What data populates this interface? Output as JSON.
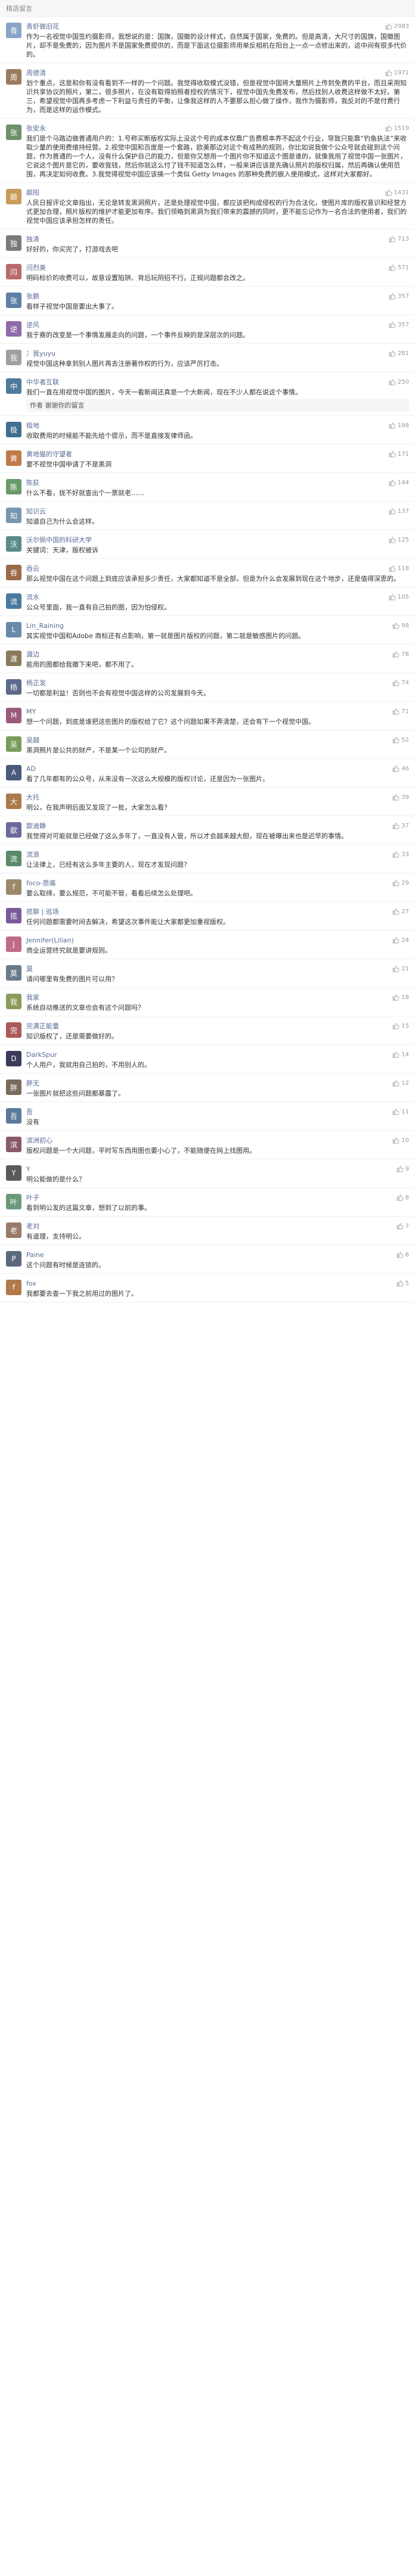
{
  "section_title": "精选留言",
  "comments": [
    {
      "name": "青虾做旧花",
      "likes": "2983",
      "avatar_color": "#8aa4c8",
      "avatar_char": "青",
      "text": "作为一名视觉中国签约摄影师，我想说的是：国旗，国徽的设计样式，自然属于国家，免费的。但是高清，大尺寸的国旗，国徽图片，却不是免费的，因为图片不是国家免费提供的，而是下面这位摄影师用单反相机在阳台上一点一点修出来的，这中间有很多代价的。"
    },
    {
      "name": "周德清",
      "likes": "1971",
      "avatar_color": "#9a7b5e",
      "avatar_char": "周",
      "text": "划个重点，这是和你有没有看到不一样的一个问题。我觉得收取模式没错，但是视觉中国将大量照片上传到免费的平台，而且采用知识共享协议的照片，第二，很多照片，在没有取得拍照者授权的情况下，视觉中国先免费发布，然后找别人收费这样做不太好。第三，希望视觉中国再多考虑一下利益与责任的平衡，让像我这样的人不要那么担心做了操作，我作为摄影师，我反对的不是付费行为，而是这样的运作模式。"
    },
    {
      "name": "张安永",
      "likes": "1519",
      "avatar_color": "#6f8f6a",
      "avatar_char": "张",
      "text": "我们是个马路边做普通用户的：1.号称买断版权实际上没这个号的成本仅靠广告费根本养不起这个行业，导致只能靠“钓鱼执法”来收取少量的使用费维持经营。2.视觉中国和百度是一个套路，欧美那边对这个有成熟的规则，你比如说我做个公众号就会碰到这个问题，作为普通的一个人，没有什么保护自己的能力，但是你又想用一个图片你不知道这个图是谁的，就像我用了视觉中国一张图片，它说这个图片是它的，要收我钱，然后你就这么付了钱不知道怎么样，一般来讲应该是先确认照片的版权归属，然后再确认使用范围，再决定如何收费。3.我觉得视觉中国应该搞一个类似 Getty Images 的那种免费的嵌入使用模式，这样对大家都好。"
    },
    {
      "name": "颠阳",
      "likes": "1431",
      "avatar_color": "#c89b5a",
      "avatar_char": "颠",
      "text": "人民日报评论文章指出，无论是转发黑洞照片，还是处理视觉中国，都应该把构成侵权的行为合法化，使图片库的版权意识和经营方式更加合理，照片版权的维护才能更加有序。我们领略到黑洞为我们带来的震撼的同时，更不能忘记作为一名合法的使用者，我们的视觉中国应该承担怎样的责任。"
    },
    {
      "name": "独清",
      "likes": "713",
      "avatar_color": "#7a7a7a",
      "avatar_char": "独",
      "text": "好好的，你买完了，打游戏去吧"
    },
    {
      "name": "闫烈美",
      "likes": "571",
      "avatar_color": "#b86b6b",
      "avatar_char": "闫",
      "text": "明码标价的收费可以，故意设置陷阱、背后玩阴招不行。正规问题都会改之。"
    },
    {
      "name": "张鹏",
      "likes": "357",
      "avatar_color": "#5d7fa3",
      "avatar_char": "张",
      "text": "看样子视觉中国是要出大事了。"
    },
    {
      "name": "逆风",
      "likes": "357",
      "avatar_color": "#8c6ba8",
      "avatar_char": "逆",
      "text": "我于赛的改变是一个事情发展走向的问题，一个事件反映的是深层次的问题。"
    },
    {
      "name": "冫我yuyu",
      "likes": "281",
      "avatar_color": "#a0a0a0",
      "avatar_char": "我",
      "text": "视觉中国这种拿到别人图片再去注册著作权的行为，应该严厉打击。"
    },
    {
      "name": "中华者互联",
      "likes": "250",
      "avatar_color": "#4f7a9a",
      "avatar_char": "中",
      "text": "我们一直在用视觉中国的图片，今天一看新闻还真是一个大新闻，现在不少人都在说这个事情。",
      "reply": "作者 谢谢你的留言"
    },
    {
      "name": "极地",
      "likes": "198",
      "avatar_color": "#3f6e8f",
      "avatar_char": "极",
      "text": "收取费用的时候能不能先给个提示，而不是直接发律师函。"
    },
    {
      "name": "黄地猫的守望者",
      "likes": "171",
      "avatar_color": "#c07a48",
      "avatar_char": "黄",
      "text": "要不视觉中国申请了不是黑洞"
    },
    {
      "name": "陈荻",
      "likes": "144",
      "avatar_color": "#6a9a6a",
      "avatar_char": "陈",
      "text": "什么不看，拢不好就查出个一票就老……"
    },
    {
      "name": "知识云",
      "likes": "137",
      "avatar_color": "#7896b0",
      "avatar_char": "知",
      "text": "知道自己为什么会这样。"
    },
    {
      "name": "沃尔佩中国的科研大学",
      "likes": "125",
      "avatar_color": "#5a8a8a",
      "avatar_char": "沃",
      "text": "关键词：天津，版权被诉"
    },
    {
      "name": "吞云",
      "likes": "118",
      "avatar_color": "#9a6a4a",
      "avatar_char": "吞",
      "text": "那么视觉中国在这个问题上到底应该承担多少责任，大家都知道不是全部，但是为什么会发展到现在这个地步，还是值得深思的。"
    },
    {
      "name": "流水",
      "likes": "105",
      "avatar_color": "#4a7aa0",
      "avatar_char": "流",
      "text": "公众号里面，我一直有自己拍的图，因为怕侵权。"
    },
    {
      "name": "Lin_Raining",
      "likes": "98",
      "avatar_color": "#6a8aaa",
      "avatar_char": "L",
      "text": "其实视觉中国和Adobe 商标还有点影响，第一就是图片版权的问题，第二就是敏感图片的问题。"
    },
    {
      "name": "渡边",
      "likes": "76",
      "avatar_color": "#8a7a5a",
      "avatar_char": "渡",
      "text": "能用的图都给我撤下来吧，都不用了。"
    },
    {
      "name": "杨正发",
      "likes": "74",
      "avatar_color": "#5a6a8a",
      "avatar_char": "杨",
      "text": "一切都是利益！否则也不会有视觉中国这样的公司发展到今天。"
    },
    {
      "name": "MY",
      "likes": "71",
      "avatar_color": "#9a5a7a",
      "avatar_char": "M",
      "text": "想一个问题，到底是谁把这些图片的版权给了它？这个问题如果不弄清楚，还会有下一个视觉中国。"
    },
    {
      "name": "吴越",
      "likes": "52",
      "avatar_color": "#7a9a5a",
      "avatar_char": "吴",
      "text": "黑洞照片是公共的财产，不是某一个公司的财产。"
    },
    {
      "name": "AD",
      "likes": "46",
      "avatar_color": "#4a5a7a",
      "avatar_char": "A",
      "text": "看了几年都有的公众号，从来没有一次这么大规模的版权讨论，还是因为一张图片。"
    },
    {
      "name": "大托",
      "likes": "39",
      "avatar_color": "#aa7a4a",
      "avatar_char": "大",
      "text": "明公，在我声明后面又发现了一批，大家怎么看？"
    },
    {
      "name": "歆迪静",
      "likes": "37",
      "avatar_color": "#6a6a9a",
      "avatar_char": "歆",
      "text": "我觉得对可能就是已经做了这么多年了，一直没有人管，所以才会越来越大胆，现在被曝出来也是迟早的事情。"
    },
    {
      "name": "流浪",
      "likes": "33",
      "avatar_color": "#5a8a6a",
      "avatar_char": "流",
      "text": "让法律上，已经有这么多年主要的人，现在才发现问题？"
    },
    {
      "name": "foco-思痛",
      "likes": "29",
      "avatar_color": "#9a8a6a",
      "avatar_char": "f",
      "text": "要么取缔，要么规范，不可能不管，看看后续怎么处理吧。"
    },
    {
      "name": "揽聊 | 巡场",
      "likes": "27",
      "avatar_color": "#7a5a9a",
      "avatar_char": "揽",
      "text": "任何问题都需要时间去解决，希望这次事件能让大家都更加重视版权。"
    },
    {
      "name": "Jennifer(Lilian)",
      "likes": "24",
      "avatar_color": "#c06a8a",
      "avatar_char": "J",
      "text": "商业运营终究就是要讲规则。"
    },
    {
      "name": "莫",
      "likes": "21",
      "avatar_color": "#6a7a8a",
      "avatar_char": "莫",
      "text": "请问哪里有免费的图片可以用？"
    },
    {
      "name": "我家",
      "likes": "18",
      "avatar_color": "#8a9a5a",
      "avatar_char": "我",
      "text": "系统自动推送的文章也会有这个问题吗？"
    },
    {
      "name": "完满正能量",
      "likes": "15",
      "avatar_color": "#aa5a5a",
      "avatar_char": "完",
      "text": "知识版权了，还是需要做好的。"
    },
    {
      "name": "DarkSpur",
      "likes": "14",
      "avatar_color": "#3a3a5a",
      "avatar_char": "D",
      "text": "个人用户，我就用自己拍的，不用别人的。"
    },
    {
      "name": "胖无",
      "likes": "12",
      "avatar_color": "#7a6a5a",
      "avatar_char": "胖",
      "text": "一张图片就把这些问题都暴露了。"
    },
    {
      "name": "吾",
      "likes": "11",
      "avatar_color": "#5a7a9a",
      "avatar_char": "吾",
      "text": "没有"
    },
    {
      "name": "滨洲初心",
      "likes": "10",
      "avatar_color": "#8a5a6a",
      "avatar_char": "滨",
      "text": "版权问题是一个大问题，平时写东西用图也要小心了，不能随便在网上找图用。"
    },
    {
      "name": "Y",
      "likes": "9",
      "avatar_color": "#5a5a5a",
      "avatar_char": "Y",
      "text": "明公能做的是什么？"
    },
    {
      "name": "叶子",
      "likes": "8",
      "avatar_color": "#6a9a7a",
      "avatar_char": "叶",
      "text": "看到明公发的这篇文章，想到了以前的事。"
    },
    {
      "name": "老刘",
      "likes": "7",
      "avatar_color": "#9a7a6a",
      "avatar_char": "老",
      "text": "有道理，支持明公。"
    },
    {
      "name": "Paine",
      "likes": "6",
      "avatar_color": "#5a6a7a",
      "avatar_char": "P",
      "text": "这个问题有时候是连锁的。"
    },
    {
      "name": "fox",
      "likes": "5",
      "avatar_color": "#b07a4a",
      "avatar_char": "f",
      "text": "我都要去查一下我之前用过的图片了。"
    }
  ]
}
